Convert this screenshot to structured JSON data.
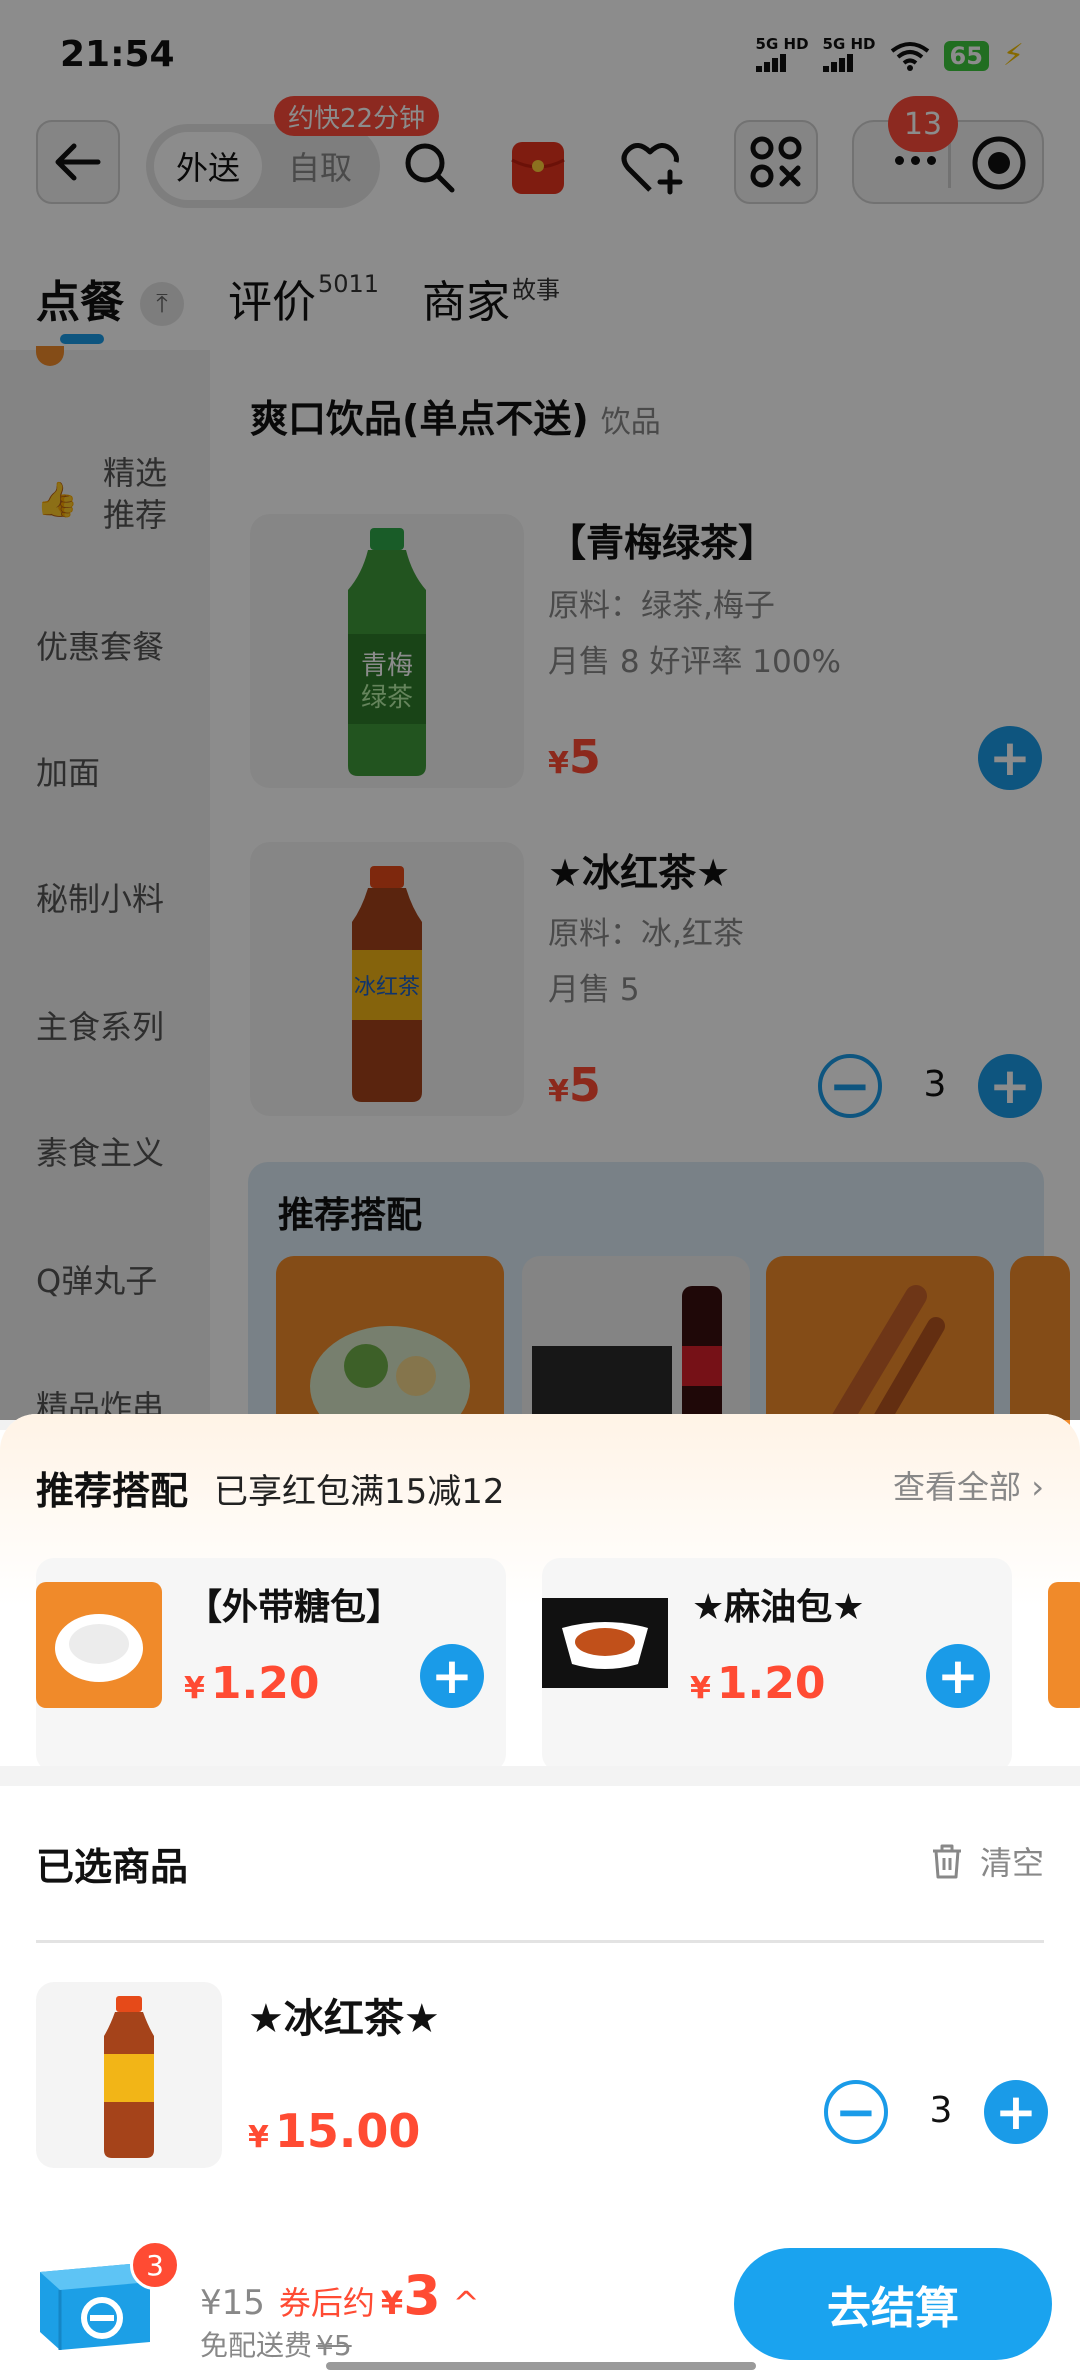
{
  "status_bar": {
    "time": "21:54",
    "signal1": "5G HD",
    "signal2": "5G HD",
    "battery": "65"
  },
  "top_bar": {
    "delivery_tab": "外送",
    "pickup_tab": "自取",
    "eta_badge": "约快22分钟",
    "more_badge": "13"
  },
  "main_tabs": [
    {
      "label": "点餐",
      "sup": ""
    },
    {
      "label": "评价",
      "sup": "5011"
    },
    {
      "label": "商家",
      "sup": "故事"
    }
  ],
  "sidebar": {
    "items": [
      "精选\n推荐",
      "优惠套餐",
      "加面",
      "秘制小料",
      "主食系列",
      "素食主义",
      "Q弹丸子",
      "精品炸串"
    ]
  },
  "section": {
    "title": "爽口饮品(单点不送)",
    "subtitle": "饮品"
  },
  "products": [
    {
      "name": "【青梅绿茶】",
      "ingredients": "原料：绿茶,梅子",
      "sales": "月售 8 好评率 100%",
      "currency": "¥",
      "price": "5",
      "qty": ""
    },
    {
      "name": "★冰红茶★",
      "ingredients": "原料：冰,红茶",
      "sales": "月售 5",
      "currency": "¥",
      "price": "5",
      "qty": "3"
    }
  ],
  "recommend_strip": {
    "title": "推荐搭配"
  },
  "sheet": {
    "title": "推荐搭配",
    "promo": "已享红包满15减12",
    "see_all": "查看全部",
    "addons": [
      {
        "name": "【外带糖包】",
        "currency": "¥",
        "price": "1.20"
      },
      {
        "name": "★麻油包★",
        "currency": "¥",
        "price": "1.20"
      }
    ],
    "selected_title": "已选商品",
    "clear_label": "清空",
    "cart_item": {
      "name": "★冰红茶★",
      "currency": "¥",
      "price": "15.00",
      "qty": "3"
    }
  },
  "footer": {
    "cart_count": "3",
    "total": "¥15",
    "coupon_label": "券后约",
    "coupon_currency": "¥",
    "coupon_value": "3",
    "fee_label": "免配送费",
    "fee_original": "¥5",
    "checkout_label": "去结算"
  },
  "colors": {
    "accent_blue": "#1a9be8",
    "price_red": "#ff4b33",
    "badge_red": "#ff4c3b"
  }
}
